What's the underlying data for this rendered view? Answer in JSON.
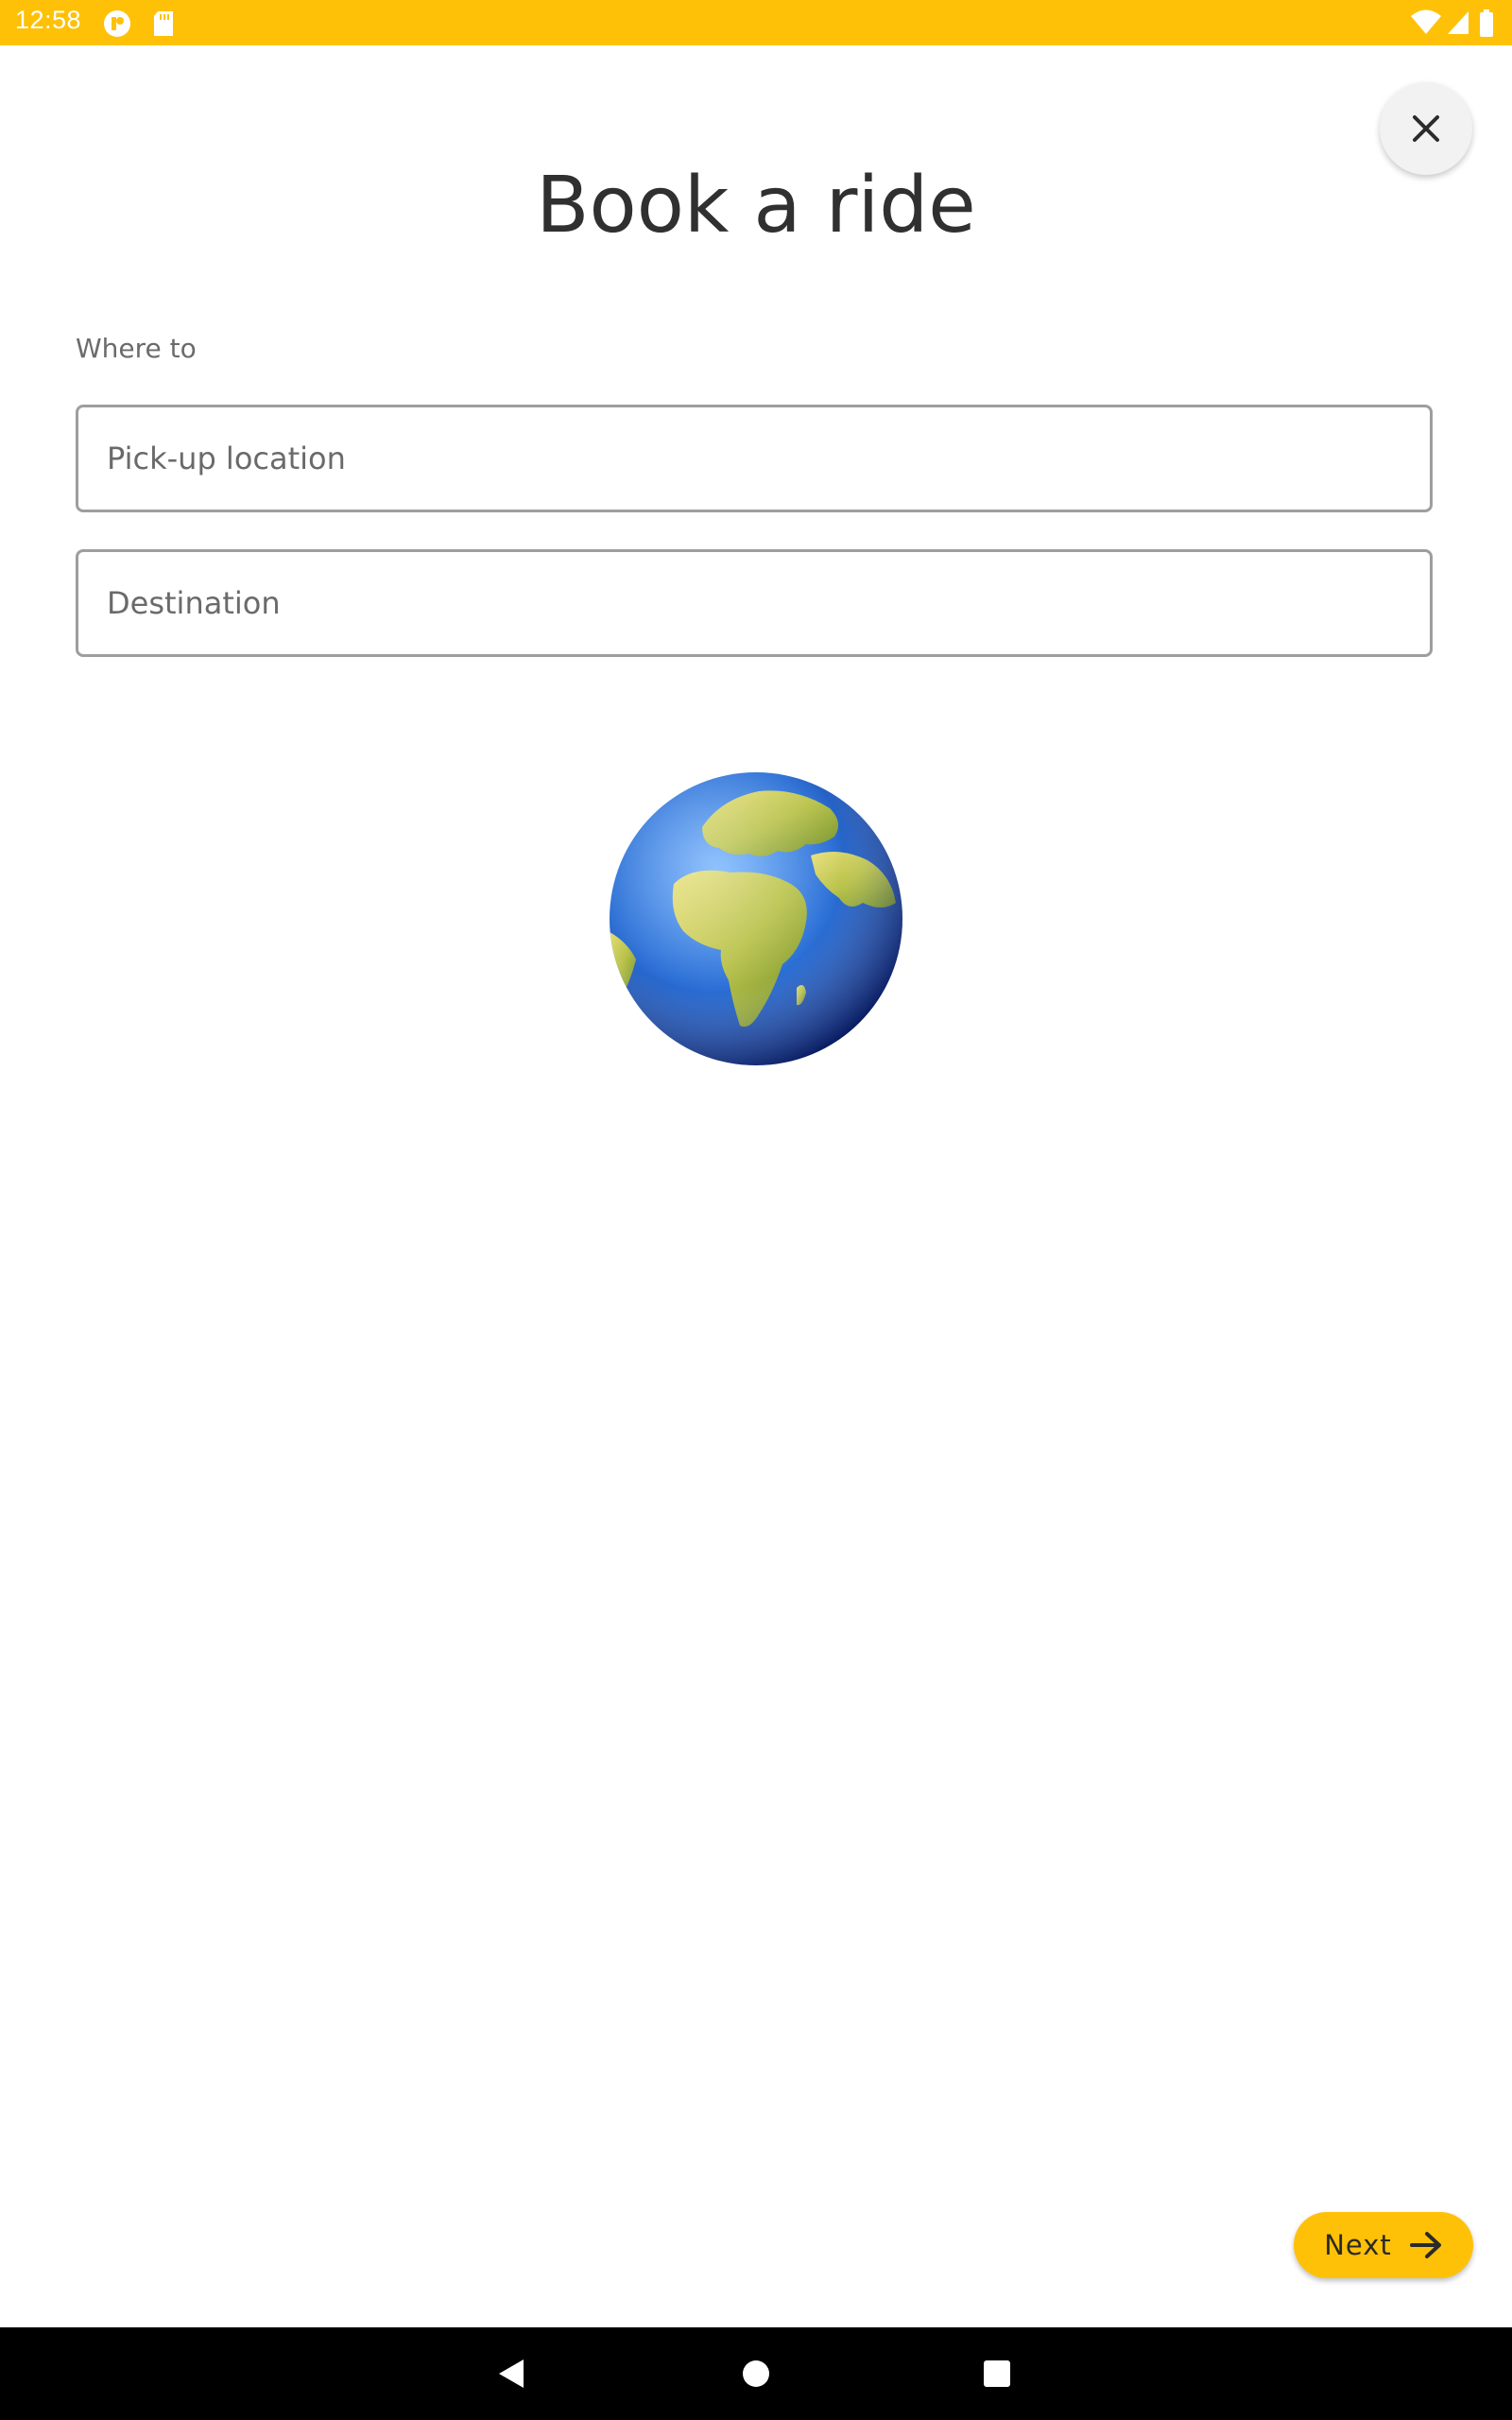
{
  "status_bar": {
    "time": "12:58",
    "background": "#FFC107",
    "left_icons": [
      "notification-app-icon",
      "sd-card-icon"
    ],
    "right_icons": [
      "wifi-icon",
      "cell-signal-icon",
      "battery-icon"
    ]
  },
  "header": {
    "title": "Book a ride",
    "close_icon": "close-icon"
  },
  "form": {
    "section_label": "Where to",
    "pickup": {
      "value": "",
      "placeholder": "Pick-up location"
    },
    "destination": {
      "value": "",
      "placeholder": "Destination"
    }
  },
  "illustration": {
    "icon": "globe-icon"
  },
  "footer": {
    "next_label": "Next",
    "next_icon": "arrow-right-icon",
    "accent": "#FFC107"
  },
  "nav_bar": {
    "icons": [
      "back-icon",
      "home-icon",
      "recents-icon"
    ]
  }
}
